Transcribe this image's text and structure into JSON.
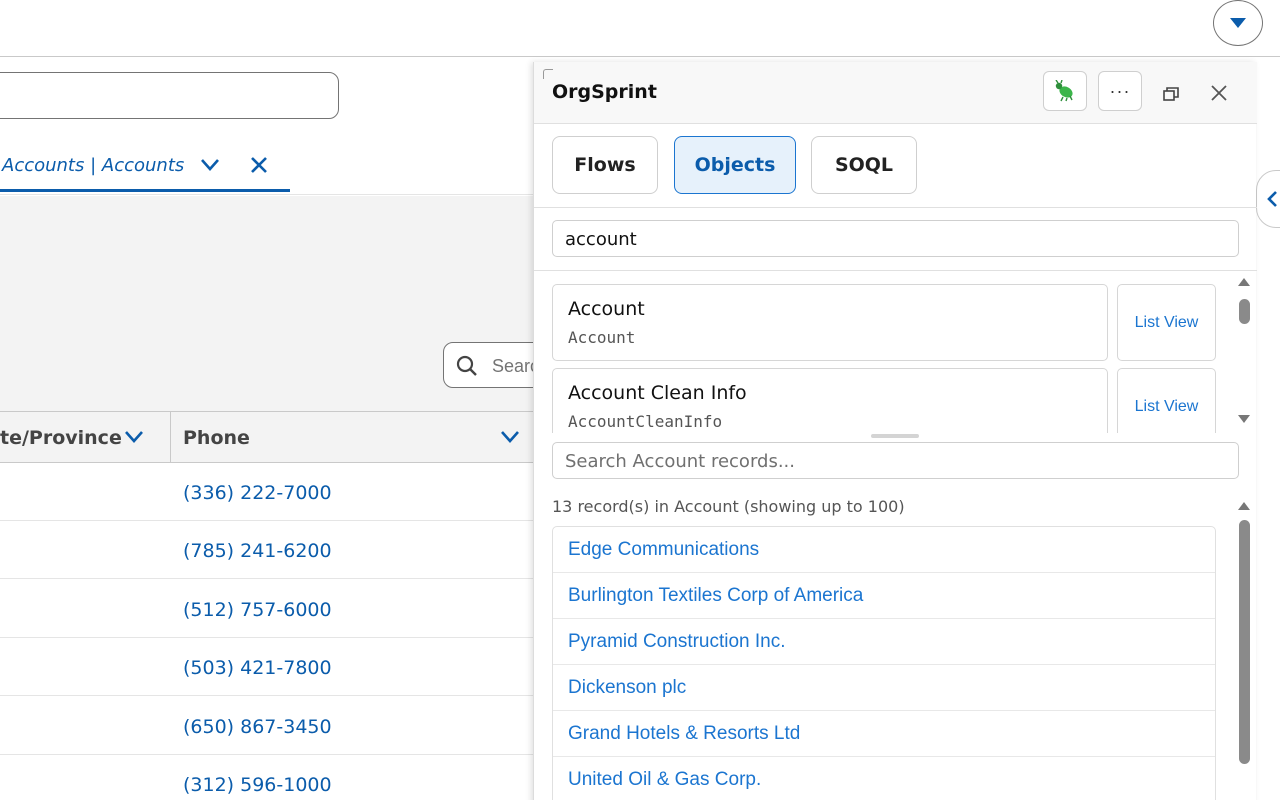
{
  "background_page": {
    "tab": {
      "label": "Accounts | Accounts"
    },
    "list_search": {
      "placeholder": "Search"
    },
    "columns": {
      "state_province": "te/Province",
      "phone": "Phone"
    },
    "phones": [
      "(336) 222-7000",
      "(785) 241-6200",
      "(512) 757-6000",
      "(503) 421-7800",
      "(650) 867-3450",
      "(312) 596-1000"
    ]
  },
  "panel": {
    "title": "OrgSprint",
    "header_icons": {
      "bug": "bug-icon",
      "more": "···",
      "restore": "restore-window-icon",
      "close": "close-icon"
    },
    "tabs": [
      {
        "label": "Flows",
        "active": false
      },
      {
        "label": "Objects",
        "active": true
      },
      {
        "label": "SOQL",
        "active": false
      }
    ],
    "object_filter": {
      "value": "account"
    },
    "objects": [
      {
        "label": "Account",
        "api_name": "Account",
        "action": "List View"
      },
      {
        "label": "Account Clean Info",
        "api_name": "AccountCleanInfo",
        "action": "List View"
      }
    ],
    "record_search": {
      "placeholder": "Search Account records..."
    },
    "record_count": "13 record(s) in Account (showing up to 100)",
    "records": [
      "Edge Communications",
      "Burlington Textiles Corp of America",
      "Pyramid Construction Inc.",
      "Dickenson plc",
      "Grand Hotels & Resorts Ltd",
      "United Oil & Gas Corp."
    ]
  },
  "colors": {
    "accent": "#0b5cab",
    "link": "#1b75d0",
    "active_tab_bg": "#e6f1fb",
    "list_header_bg": "#f3f3f3"
  }
}
